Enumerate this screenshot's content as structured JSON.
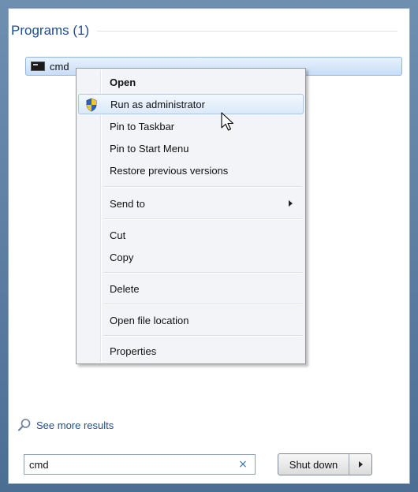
{
  "programs": {
    "header": "Programs (1)",
    "items": [
      {
        "label": "cmd",
        "icon": "cmd-icon"
      }
    ]
  },
  "context_menu": {
    "items": [
      {
        "label": "Open",
        "bold": true
      },
      {
        "label": "Run as administrator",
        "icon": "uac-shield-icon",
        "highlighted": true
      },
      {
        "label": "Pin to Taskbar"
      },
      {
        "label": "Pin to Start Menu"
      },
      {
        "label": "Restore previous versions"
      },
      {
        "label": "Send to",
        "submenu": true
      },
      {
        "label": "Cut"
      },
      {
        "label": "Copy"
      },
      {
        "label": "Delete"
      },
      {
        "label": "Open file location"
      },
      {
        "label": "Properties"
      }
    ]
  },
  "see_more": {
    "label": "See more results",
    "icon": "search-icon"
  },
  "search": {
    "value": "cmd",
    "clear_icon": "clear-icon",
    "clear_glyph": "×"
  },
  "shutdown": {
    "label": "Shut down",
    "arrow_icon": "chevron-right-icon"
  },
  "colors": {
    "header_blue": "#1e4f91",
    "highlight_border": "#a8c8ec",
    "frame_blue": "#4c6e93"
  }
}
